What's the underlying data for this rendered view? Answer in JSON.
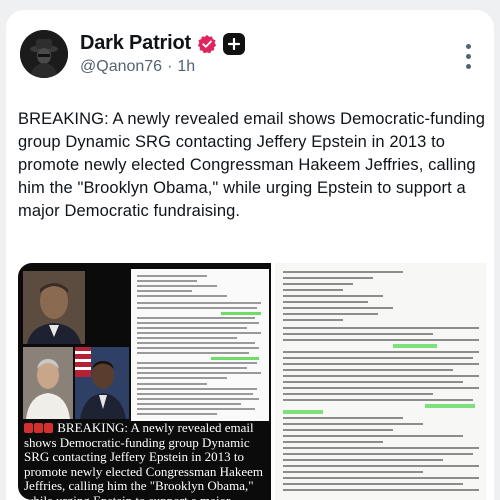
{
  "post": {
    "author_name": "Dark Patriot",
    "handle": "@Qanon76",
    "separator": "·",
    "time": "1h",
    "text": "BREAKING: A newly revealed email shows Democratic-funding group Dynamic SRG contacting Jeffery Epstein in 2013 to promote newly elected Congressman Hakeem Jeffries, calling him the \"Brooklyn Obama,\" while urging Epstein to support a major Democratic fundraising."
  },
  "media": {
    "caption": "BREAKING: A newly revealed email shows Democratic-funding group Dynamic SRG contacting Jeffery Epstein in 2013 to promote newly elected Congressman Hakeem Jeffries, calling him the \"Brooklyn Obama,\" while urging Epstein to support a major Democratic fundraising push."
  },
  "icons": {
    "avatar": "masked-figure-avatar",
    "verified": "verified-badge-icon",
    "plus": "plus-square-icon",
    "more": "more-vertical-icon"
  },
  "colors": {
    "verified_badge": "#e0245e",
    "highlight": "#6fdc6a",
    "handle_text": "#536471"
  }
}
